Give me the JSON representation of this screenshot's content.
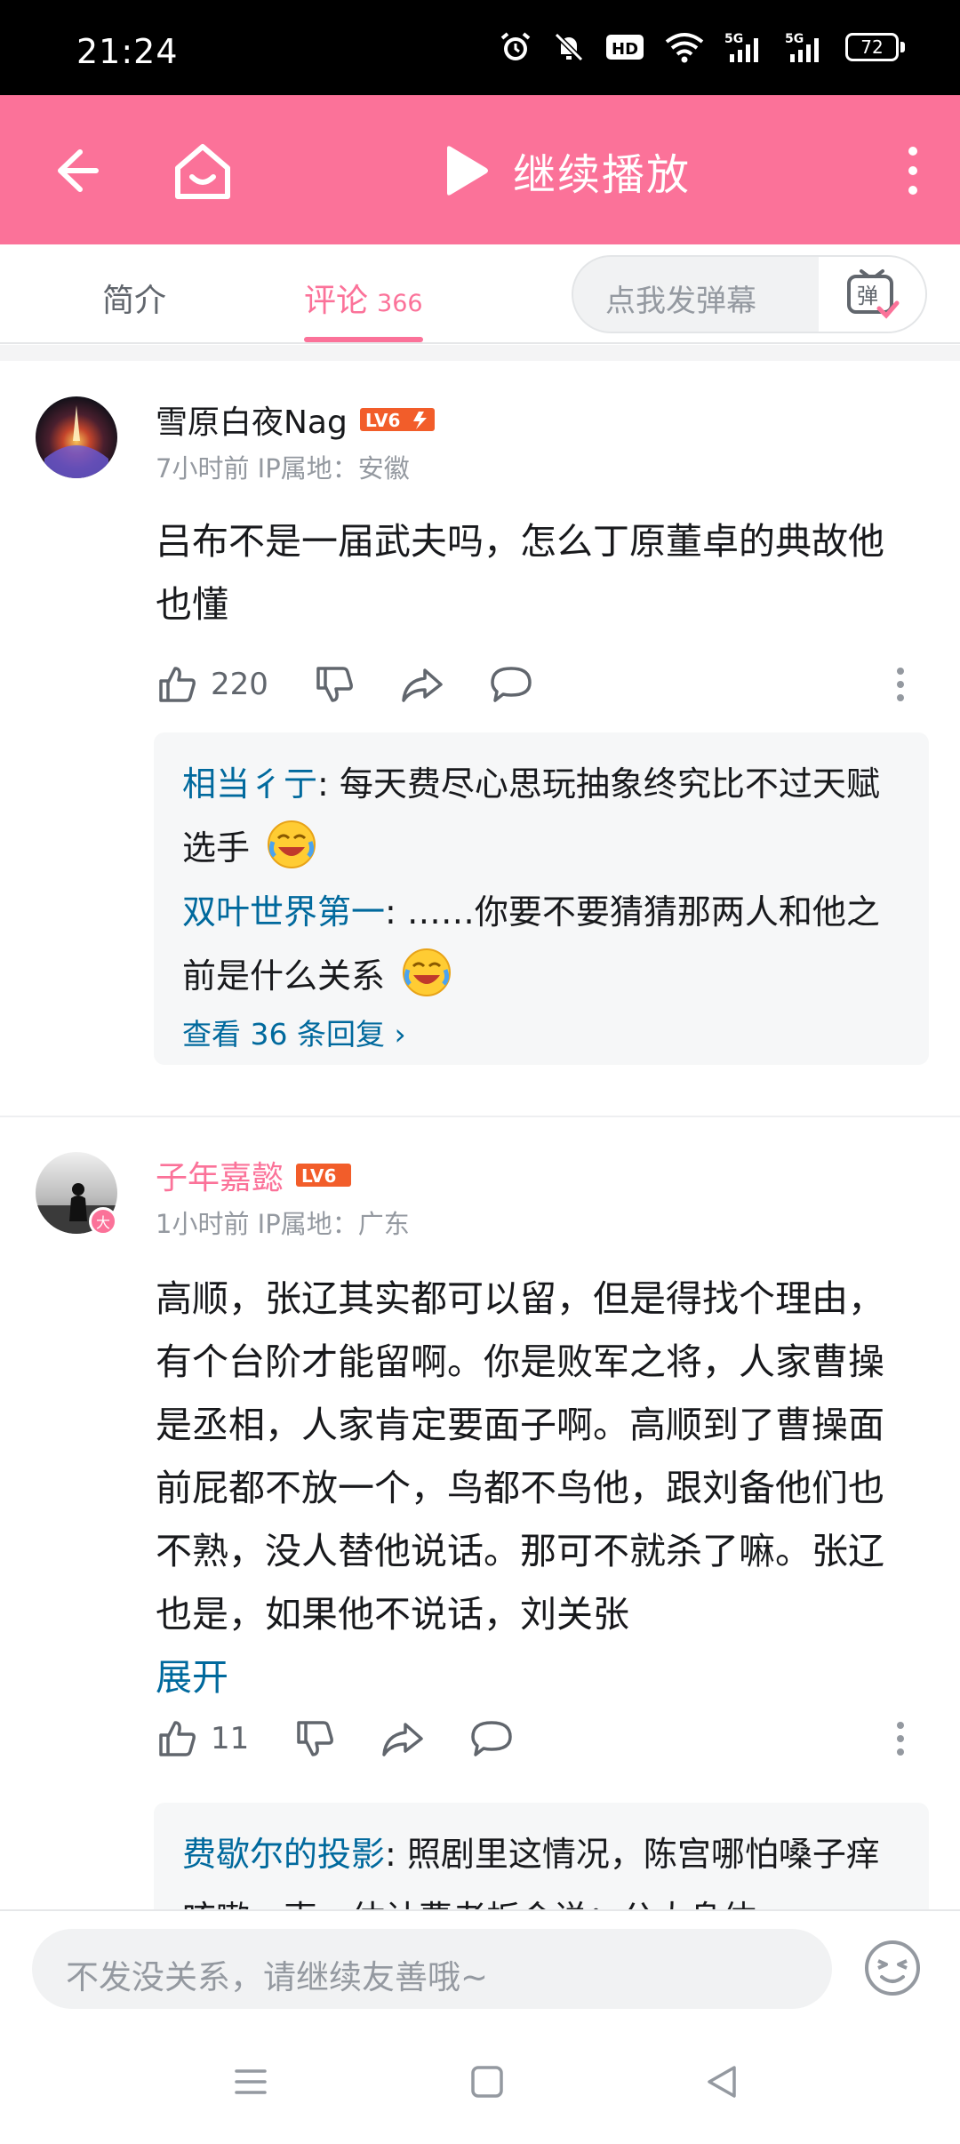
{
  "status_bar": {
    "time": "21:24",
    "battery": "72",
    "network_1": "5G",
    "network_2": "5G"
  },
  "top_bar": {
    "play_label": "继续播放"
  },
  "tabs": {
    "intro": "简介",
    "comments": "评论",
    "comment_count": "366",
    "danmaku_placeholder": "点我发弹幕",
    "danmaku_btn": "弹"
  },
  "comments": [
    {
      "username": "雪原白夜Nag",
      "level": "LV6",
      "time": "7小时前",
      "ip": "IP属地：安徽",
      "text": "吕布不是一届武夫吗，怎么丁原董卓的典故他也懂",
      "likes": "220",
      "replies": [
        {
          "user": "相当彳亍",
          "text": ": 每天费尽心思玩抽象终究比不过天赋选手"
        },
        {
          "user": "双叶世界第一",
          "text": ": ……你要不要猜猜那两人和他之前是什么关系"
        }
      ],
      "view_replies": "查看 36 条回复 ›"
    },
    {
      "username": "子年嘉懿",
      "level": "LV6",
      "time": "1小时前",
      "ip": "IP属地：广东",
      "text": "高顺，张辽其实都可以留，但是得找个理由，有个台阶才能留啊。你是败军之将，人家曹操是丞相，人家肯定要面子啊。高顺到了曹操面前屁都不放一个，鸟都不鸟他，跟刘备他们也不熟，没人替他说话。那可不就杀了嘛。张辽也是，如果他不说话，刘关张",
      "expand": "展开",
      "likes": "11",
      "replies": [
        {
          "user": "费歇尔的投影",
          "text": ": 照剧里这情况，陈宫哪怕嗓子痒咳嗽一声，估计曹老板会说：公大身体"
        }
      ]
    }
  ],
  "bottom": {
    "input_placeholder": "不发没关系，请继续友善哦~"
  },
  "colors": {
    "accent": "#fb7299",
    "link": "#00699d",
    "level_badge": "#f25d2a"
  }
}
